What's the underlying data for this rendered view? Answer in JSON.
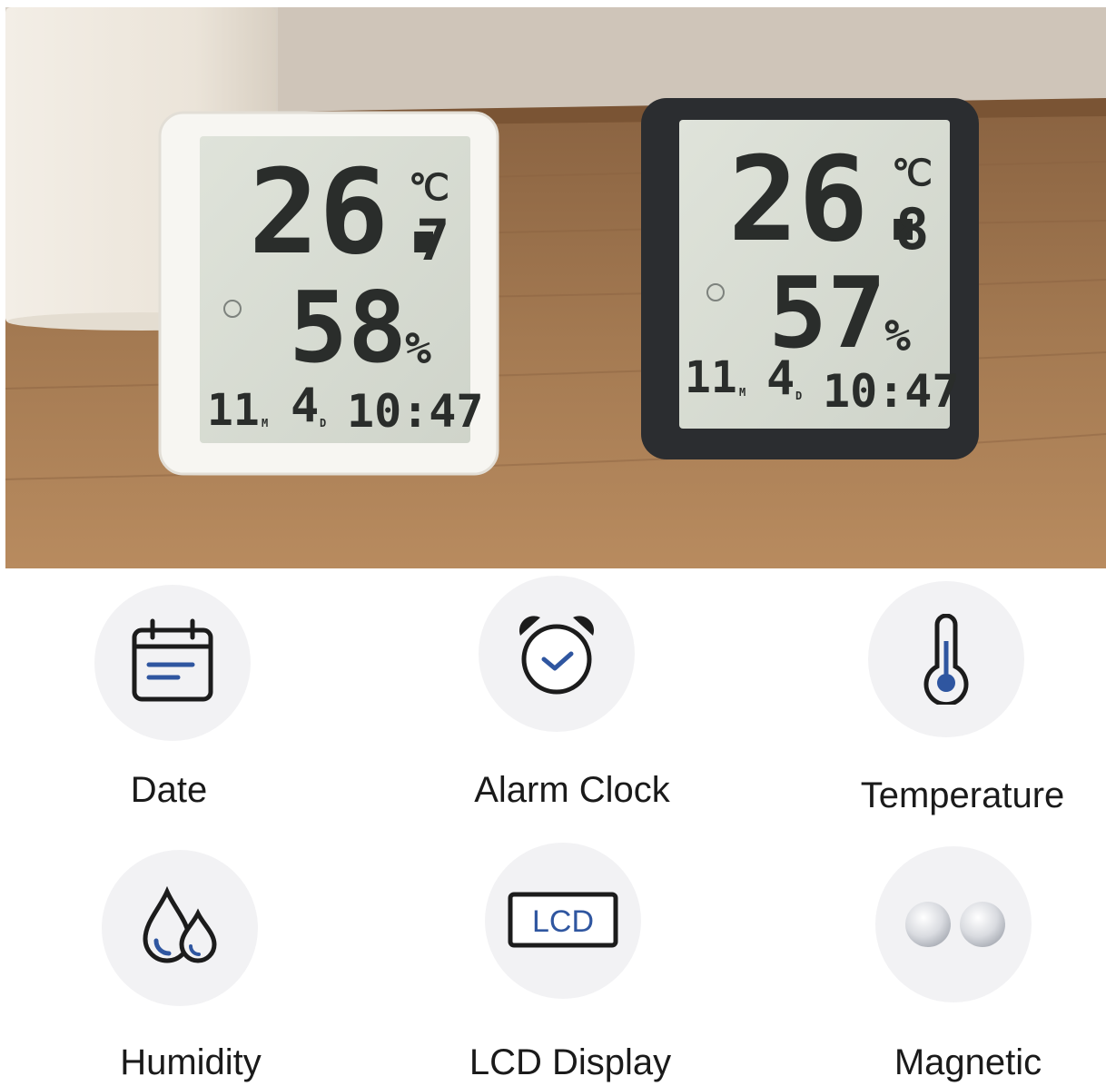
{
  "product_photo": {
    "white_device": {
      "temp_main": "26.",
      "temp_decimal": "7",
      "temp_unit": "℃",
      "humidity": "58",
      "humidity_unit": "%",
      "month": "11",
      "month_unit": "M",
      "day": "4",
      "day_unit": "D",
      "time": "10:47"
    },
    "black_device": {
      "temp_main": "26.",
      "temp_decimal": "8",
      "temp_unit": "℃",
      "humidity": "57",
      "humidity_unit": "%",
      "month": "11",
      "month_unit": "M",
      "day": "4",
      "day_unit": "D",
      "time": "10:47"
    }
  },
  "features": [
    {
      "label": "Date",
      "icon": "calendar-icon"
    },
    {
      "label": "Alarm Clock",
      "icon": "alarm-clock-icon"
    },
    {
      "label": "Temperature",
      "icon": "thermometer-icon"
    },
    {
      "label": "Humidity",
      "icon": "water-drops-icon"
    },
    {
      "label": "LCD Display",
      "icon": "lcd-icon",
      "icon_text": "LCD"
    },
    {
      "label": "Magnetic",
      "icon": "magnets-icon"
    }
  ],
  "colors": {
    "icon_stroke": "#1c1c1c",
    "icon_accent": "#2f56a0",
    "icon_bg": "#f2f2f4",
    "lcd_screen": "#d9ddd4"
  }
}
